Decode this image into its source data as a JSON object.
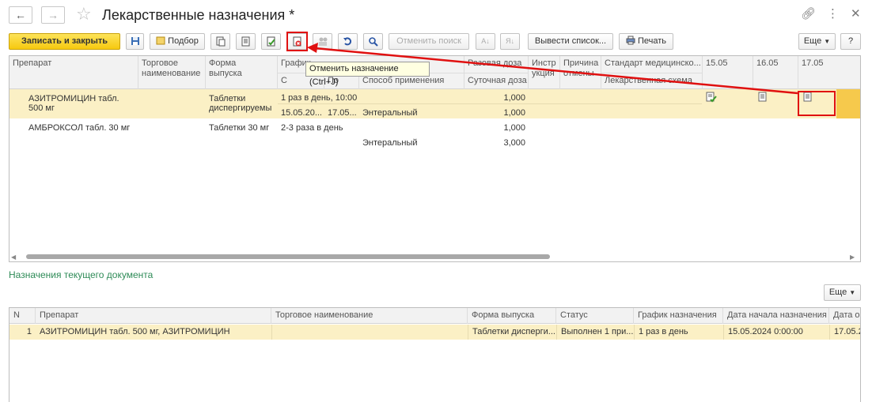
{
  "window": {
    "title": "Лекарственные назначения *"
  },
  "toolbar": {
    "save_close": "Записать и закрыть",
    "podbor": "Подбор",
    "cancel_search": "Отменить поиск",
    "export_list": "Вывести список...",
    "print": "Печать",
    "more": "Еще",
    "help": "?"
  },
  "tooltip": "Отменить назначение (Ctrl+J)",
  "upper_grid": {
    "headers": {
      "drug": "Препарат",
      "trade_name_1": "Торговое",
      "trade_name_2": "наименование",
      "form_1": "Форма",
      "form_2": "выпуска",
      "schedule": "График",
      "from": "С",
      "to": "По",
      "method": "Способ применения",
      "single_dose": "Разовая доза",
      "daily_dose": "Суточная доза",
      "instr_1": "Инстр",
      "instr_2": "укция",
      "reason_1": "Причина",
      "reason_2": "отмены",
      "standard": "Стандарт медицинско...",
      "scheme": "Лекарственная схема",
      "d1": "15.05",
      "d2": "16.05",
      "d3": "17.05"
    },
    "rows": [
      {
        "drug_1": "АЗИТРОМИЦИН табл.",
        "drug_2": "500 мг",
        "form_1": "Таблетки",
        "form_2": "диспергируемы",
        "schedule": "1 раз в день, 10:00",
        "from": "15.05.20...",
        "to": "17.05...",
        "method": "Энтеральный",
        "single_dose": "1,000",
        "daily_dose": "1,000"
      },
      {
        "drug": "АМБРОКСОЛ табл. 30 мг",
        "form": "Таблетки 30 мг",
        "schedule": "2-3 раза в день",
        "method": "Энтеральный",
        "single_dose": "1,000",
        "daily_dose": "3,000"
      }
    ]
  },
  "section_title": "Назначения текущего документа",
  "lower_more": "Еще",
  "lower_grid": {
    "headers": [
      "N",
      "Препарат",
      "Торговое наименование",
      "Форма выпуска",
      "Статус",
      "График назначения",
      "Дата начала назначения",
      "Дата о"
    ],
    "row": {
      "n": "1",
      "drug": "АЗИТРОМИЦИН табл. 500 мг, АЗИТРОМИЦИН",
      "trade": "",
      "form": "Таблетки дисперги...",
      "status": "Выполнен 1 при...",
      "schedule": "1 раз в день",
      "start": "15.05.2024 0:00:00",
      "end": "17.05.2"
    }
  },
  "colors": {
    "accent_yellow": "#f6c90f",
    "selection": "#fbf0c5",
    "annotation_red": "#e01010",
    "section_green": "#2e8b57"
  }
}
